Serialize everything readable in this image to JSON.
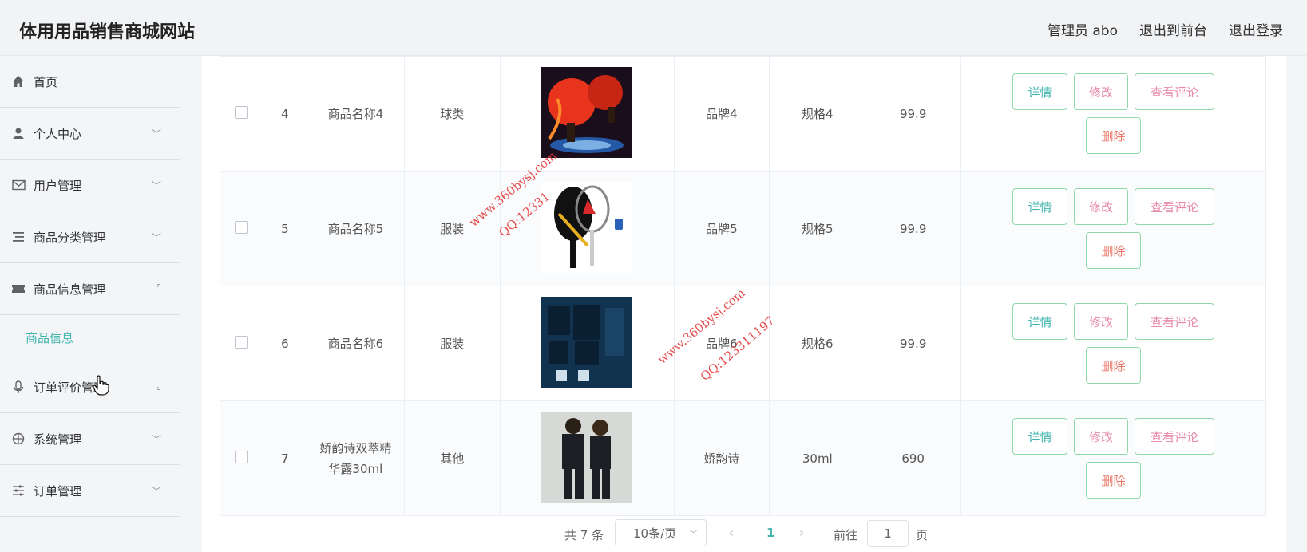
{
  "header": {
    "title": "体用用品销售商城网站",
    "admin": "管理员 abo",
    "to_front": "退出到前台",
    "logout": "退出登录"
  },
  "sidebar": {
    "items": [
      {
        "label": "首页",
        "icon": "home-icon"
      },
      {
        "label": "个人中心",
        "icon": "user-icon"
      },
      {
        "label": "用户管理",
        "icon": "mail-icon"
      },
      {
        "label": "商品分类管理",
        "icon": "list-icon"
      },
      {
        "label": "商品信息管理",
        "icon": "ticket-icon"
      },
      {
        "label": "订单评价管理",
        "icon": "microphone-icon"
      },
      {
        "label": "系统管理",
        "icon": "compass-icon"
      },
      {
        "label": "订单管理",
        "icon": "sliders-icon"
      }
    ],
    "sub_item": "商品信息"
  },
  "table": {
    "rows": [
      {
        "id": "4",
        "name": "商品名称4",
        "category": "球类",
        "brand": "品牌4",
        "spec": "规格4",
        "price": "99.9"
      },
      {
        "id": "5",
        "name": "商品名称5",
        "category": "服装",
        "brand": "品牌5",
        "spec": "规格5",
        "price": "99.9"
      },
      {
        "id": "6",
        "name": "商品名称6",
        "category": "服装",
        "brand": "品牌6",
        "spec": "规格6",
        "price": "99.9"
      },
      {
        "id": "7",
        "name": "娇韵诗双萃精华露30ml",
        "category": "其他",
        "brand": "娇韵诗",
        "spec": "30ml",
        "price": "690"
      }
    ],
    "actions": {
      "detail": "详情",
      "edit": "修改",
      "review": "查看评论",
      "delete": "删除"
    }
  },
  "pagination": {
    "total": "共 7 条",
    "page_size": "10条/页",
    "current": "1",
    "goto_label": "前往",
    "goto_value": "1",
    "goto_unit": "页"
  },
  "watermark": {
    "site": "www.360bysj.com",
    "qq": "QQ:123311197",
    "qq_partial": "QQ:12331"
  },
  "colors": {
    "accent": "#3fb4ad",
    "edit": "#e78aa7",
    "delete": "#e97565"
  }
}
